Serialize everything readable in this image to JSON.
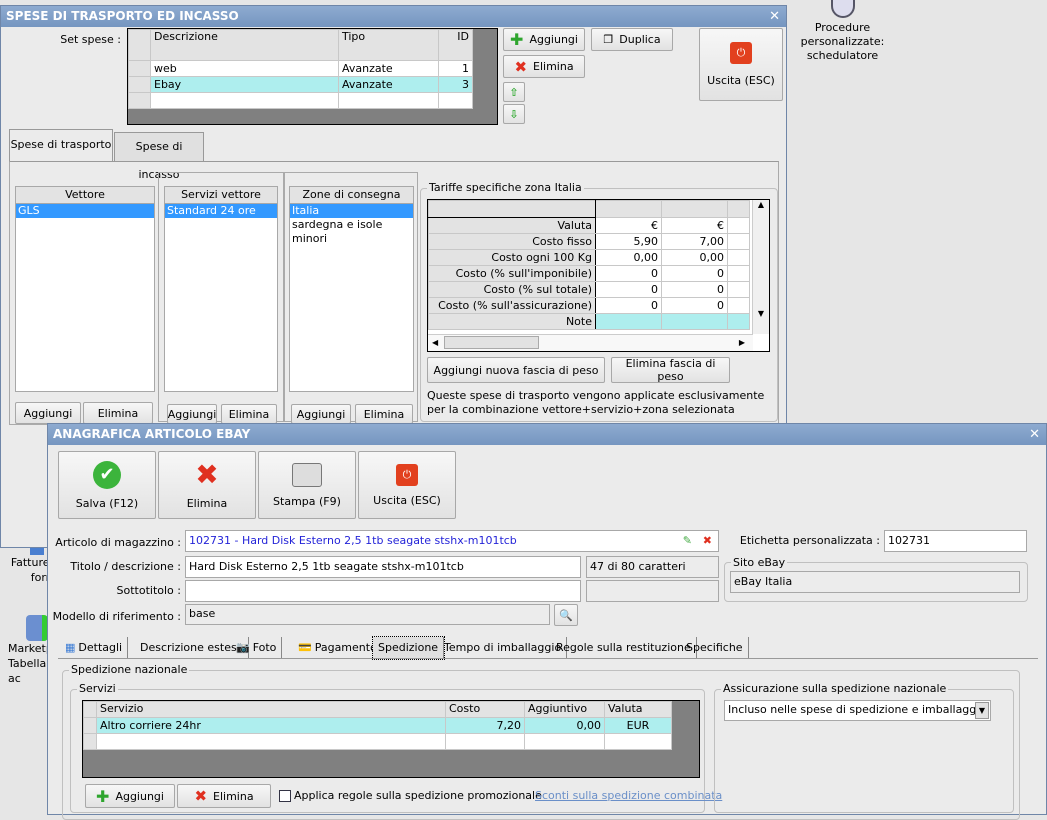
{
  "desktop": {
    "icon_top_label": "Procedure personalizzate: schedulatore",
    "icon_fatture": "Fatture d fornit",
    "icon_market": "Marketp Tabella ac"
  },
  "win1": {
    "title": "SPESE DI TRASPORTO ED INCASSO",
    "set_spese_label": "Set spese :",
    "set_columns": [
      "Descrizione",
      "Tipo",
      "ID"
    ],
    "set_rows": [
      {
        "descrizione": "web",
        "tipo": "Avanzate",
        "id": "1"
      },
      {
        "descrizione": "Ebay",
        "tipo": "Avanzate",
        "id": "3"
      }
    ],
    "buttons": {
      "aggiungi": "Aggiungi",
      "elimina": "Elimina",
      "duplica": "Duplica",
      "uscita": "Uscita (ESC)"
    },
    "tabs": [
      "Spese di trasporto",
      "Spese di incasso"
    ],
    "vettore": {
      "title": "Vettore",
      "items": [
        "GLS"
      ]
    },
    "servizi": {
      "title": "Servizi vettore",
      "items": [
        "Standard 24 ore"
      ]
    },
    "zone": {
      "title": "Zone di consegna",
      "items": [
        "Italia",
        "sardegna e isole minori"
      ]
    },
    "list_buttons": {
      "aggiungi": "Aggiungi",
      "elimina": "Elimina"
    },
    "tariffe": {
      "title": "Tariffe specifiche zona Italia",
      "rows": [
        {
          "label": "Valuta",
          "v": [
            "€",
            "€"
          ]
        },
        {
          "label": "Costo fisso",
          "v": [
            "5,90",
            "7,00"
          ]
        },
        {
          "label": "Costo ogni 100 Kg",
          "v": [
            "0,00",
            "0,00"
          ]
        },
        {
          "label": "Costo (% sull'imponibile)",
          "v": [
            "0",
            "0"
          ]
        },
        {
          "label": "Costo (% sul totale)",
          "v": [
            "0",
            "0"
          ]
        },
        {
          "label": "Costo (% sull'assicurazione)",
          "v": [
            "0",
            "0"
          ]
        },
        {
          "label": "Note",
          "v": [
            "",
            ""
          ]
        }
      ],
      "add_btn": "Aggiungi nuova fascia di peso",
      "del_btn": "Elimina fascia di peso",
      "note": "Queste spese di trasporto vengono applicate esclusivamente per la combinazione vettore+servizio+zona selezionata"
    }
  },
  "win2": {
    "title": "ANAGRAFICA ARTICOLO EBAY",
    "toolbar": {
      "salva": "Salva (F12)",
      "elimina": "Elimina",
      "stampa": "Stampa (F9)",
      "uscita": "Uscita (ESC)"
    },
    "articolo_label": "Articolo di magazzino :",
    "articolo_value": "102731 - Hard Disk Esterno 2,5 1tb seagate stshx-m101tcb",
    "titolo_label": "Titolo / descrizione :",
    "titolo_value": "Hard Disk Esterno 2,5 1tb seagate stshx-m101tcb",
    "char_count": "47 di 80 caratteri",
    "sottotitolo_label": "Sottotitolo :",
    "sottotitolo_value": "",
    "modello_label": "Modello di riferimento :",
    "modello_value": "base",
    "etichetta_label": "Etichetta personalizzata :",
    "etichetta_value": "102731",
    "sito_label": "Sito eBay",
    "sito_value": "eBay Italia",
    "tabs": [
      "Dettagli",
      "Descrizione estesa",
      "Foto",
      "Pagamento",
      "Spedizione",
      "Tempo di imballaggio",
      "Regole sulla restituzione",
      "Specifiche"
    ],
    "spedizione_nazionale": "Spedizione nazionale",
    "servizi_label": "Servizi",
    "servizi_columns": [
      "Servizio",
      "Costo",
      "Aggiuntivo",
      "Valuta"
    ],
    "servizi_rows": [
      {
        "servizio": "Altro corriere 24hr",
        "costo": "7,20",
        "aggiuntivo": "0,00",
        "valuta": "EUR"
      }
    ],
    "aggiungi": "Aggiungi",
    "elimina": "Elimina",
    "promo_label": "Applica regole sulla spedizione promozionale",
    "promo_checked": false,
    "sconti_link": "Sconti sulla spedizione combinata",
    "assicurazione_label": "Assicurazione sulla spedizione nazionale",
    "assicurazione_value": "Incluso nelle spese di spedizione e imballaggio"
  },
  "colors": {
    "selected_row": "#aeeeee",
    "title_bar": "#7b9cc6",
    "link": "#6a8fc8"
  }
}
